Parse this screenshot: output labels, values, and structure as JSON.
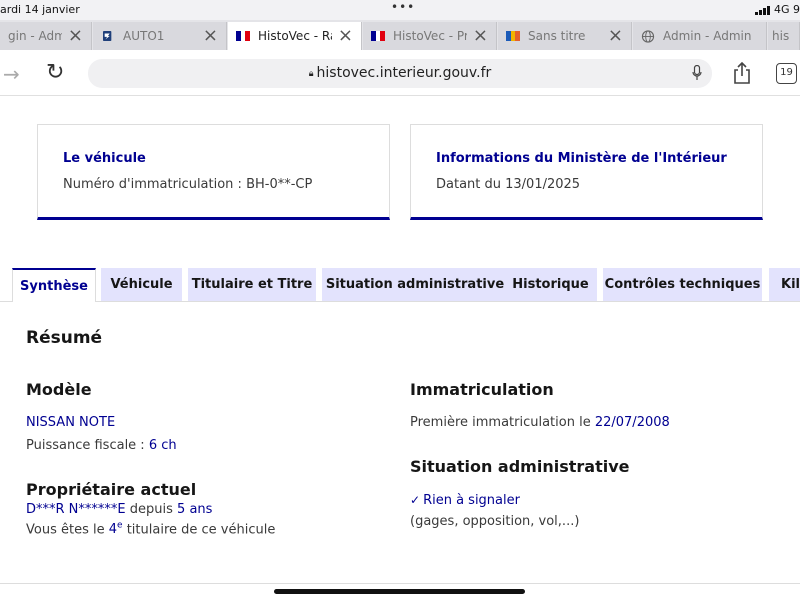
{
  "status_bar": {
    "date": "ardi 14 janvier",
    "network": "4G 9"
  },
  "browser_tabs": [
    {
      "label": "gin - Admin C",
      "active": false
    },
    {
      "label": "AUTO1",
      "active": false
    },
    {
      "label": "HistoVec - Rapport",
      "active": true
    },
    {
      "label": "HistoVec - Propriétaire",
      "active": false
    },
    {
      "label": "Sans titre",
      "active": false
    },
    {
      "label": "Admin - Admin",
      "active": false
    },
    {
      "label": "his",
      "active": false
    }
  ],
  "url_bar": {
    "url": "histovec.interieur.gouv.fr",
    "tab_count": "19"
  },
  "vehicle_card": {
    "title": "Le véhicule",
    "plate_label": "Numéro d'immatriculation : BH-0**-CP"
  },
  "ministry_card": {
    "title": "Informations du Ministère de l'Intérieur",
    "date_label": "Datant du 13/01/2025"
  },
  "page_tabs": [
    "Synthèse",
    "Véhicule",
    "Titulaire et Titre",
    "Situation administrative",
    "Historique",
    "Contrôles techniques",
    "Kilo"
  ],
  "summary": {
    "heading": "Résumé",
    "model_heading": "Modèle",
    "model_name": "NISSAN NOTE",
    "power_label": "Puissance fiscale :",
    "power_value": "6 ch",
    "owner_heading": "Propriétaire actuel",
    "owner_name": "D***R N******E",
    "owner_since_label": "depuis",
    "owner_since_value": "5 ans",
    "holder_prefix": "Vous êtes le",
    "holder_rank": "4",
    "holder_rank_suffix": "e",
    "holder_suffix": "titulaire de ce véhicule",
    "registration_heading": "Immatriculation",
    "first_registration_label": "Première immatriculation le",
    "first_registration_date": "22/07/2008",
    "admin_heading": "Situation administrative",
    "admin_status": "Rien à signaler",
    "admin_details": "(gages, opposition, vol,...)"
  },
  "colors": {
    "accent": "#000091",
    "tab_background": "#e3e3fd"
  }
}
